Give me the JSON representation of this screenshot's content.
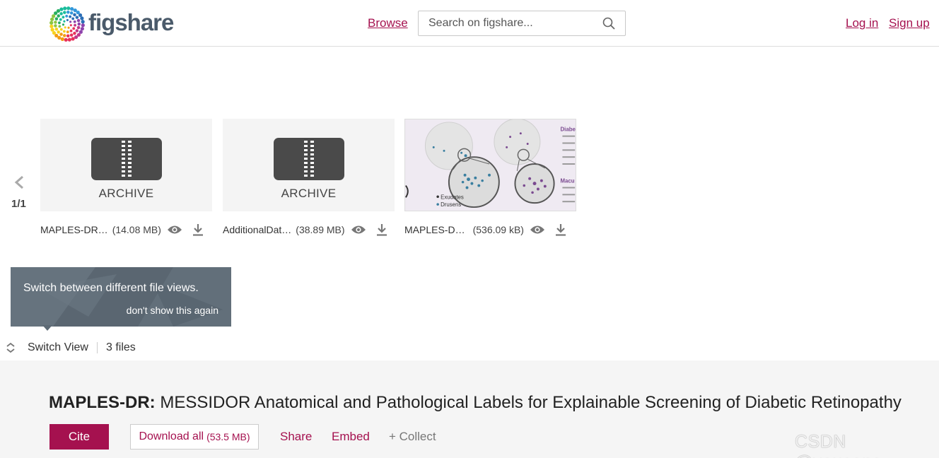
{
  "header": {
    "logo_text": "figshare",
    "browse_label": "Browse",
    "search_placeholder": "Search on figshare...",
    "login_label": "Log in",
    "signup_label": "Sign up"
  },
  "carousel": {
    "pager": "1/1",
    "files": [
      {
        "thumb_label": "ARCHIVE",
        "name": "MAPLES-DR…",
        "size": "(14.08 MB)"
      },
      {
        "thumb_label": "ARCHIVE",
        "name": "AdditionalDat…",
        "size": "(38.89 MB)"
      },
      {
        "name": "MAPLES-D…",
        "size": "(536.09 kB)"
      }
    ],
    "image_thumb": {
      "legend_exudates": "Exudates",
      "legend_drusens": "Drusens",
      "side_title_1": "Diabe",
      "side_title_2": "Macu"
    }
  },
  "tooltip": {
    "text": "Switch between different file views.",
    "dismiss": "don't show this again"
  },
  "switch_view": {
    "label": "Switch View",
    "count": "3 files"
  },
  "article": {
    "title_bold": "MAPLES-DR:",
    "title_rest": " MESSIDOR Anatomical and Pathological Labels for Explainable Screening of Diabetic Retinopathy",
    "cite_label": "Cite",
    "download_label": "Download all",
    "download_size": "(53.5 MB)",
    "share_label": "Share",
    "embed_label": "Embed",
    "collect_label": "+ Collect"
  },
  "watermark": "CSDN @youcans_",
  "colors": {
    "accent": "#a5114f",
    "tooltip_bg": "#5d6a75",
    "section_bg": "#f5f5f5"
  }
}
